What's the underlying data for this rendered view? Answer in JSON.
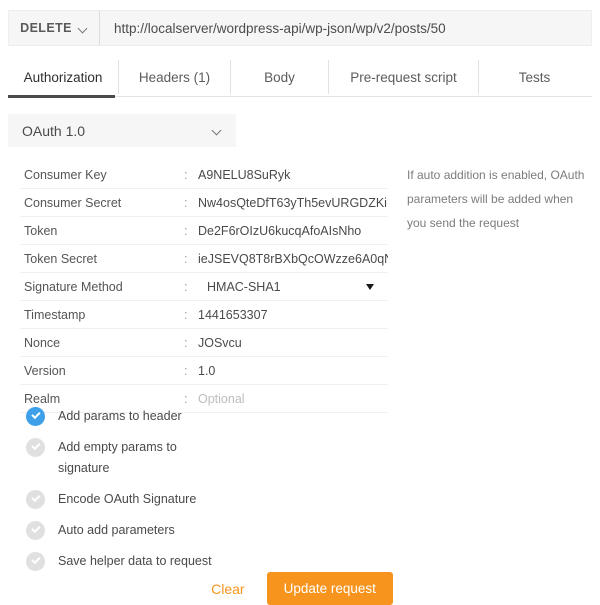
{
  "request_bar": {
    "method": "DELETE",
    "method_icon": "chevron-down-icon",
    "url": "http://localserver/wordpress-api/wp-json/wp/v2/posts/50"
  },
  "tabs": [
    {
      "label": "Authorization",
      "active": true
    },
    {
      "label": "Headers (1)",
      "active": false
    },
    {
      "label": "Body",
      "active": false
    },
    {
      "label": "Pre-request script",
      "active": false
    },
    {
      "label": "Tests",
      "active": false
    }
  ],
  "auth_type": {
    "selected": "OAuth 1.0",
    "icon": "chevron-down-icon"
  },
  "fields": [
    {
      "label": "Consumer Key",
      "separator": ":",
      "value": "A9NELU8SuRyk",
      "placeholder": false,
      "dropdown": false
    },
    {
      "label": "Consumer Secret",
      "separator": ":",
      "value": "Nw4osQteDfT63yTh5evURGDZKi",
      "placeholder": false,
      "dropdown": false
    },
    {
      "label": "Token",
      "separator": ":",
      "value": "De2F6rOIzU6kucqAfoAIsNho",
      "placeholder": false,
      "dropdown": false
    },
    {
      "label": "Token Secret",
      "separator": ":",
      "value": "ieJSEVQ8T8rBXbQcOWzze6A0qN",
      "placeholder": false,
      "dropdown": false
    },
    {
      "label": "Signature Method",
      "separator": ":",
      "value": "HMAC-SHA1",
      "placeholder": false,
      "dropdown": true
    },
    {
      "label": "Timestamp",
      "separator": ":",
      "value": "1441653307",
      "placeholder": false,
      "dropdown": false
    },
    {
      "label": "Nonce",
      "separator": ":",
      "value": "JOSvcu",
      "placeholder": false,
      "dropdown": false
    },
    {
      "label": "Version",
      "separator": ":",
      "value": "1.0",
      "placeholder": false,
      "dropdown": false
    },
    {
      "label": "Realm",
      "separator": ":",
      "value": "Optional",
      "placeholder": true,
      "dropdown": false
    }
  ],
  "help": {
    "text": "If auto addition is enabled, OAuth parameters will be added when you send the request"
  },
  "checkboxes": [
    {
      "label": "Add params to header",
      "checked": true
    },
    {
      "label": "Add empty params to signature",
      "checked": false
    },
    {
      "label": "Encode OAuth Signature",
      "checked": false
    },
    {
      "label": "Auto add parameters",
      "checked": false
    },
    {
      "label": "Save helper data to request",
      "checked": false
    }
  ],
  "actions": {
    "clear_label": "Clear",
    "update_label": "Update request"
  },
  "colors": {
    "accent_orange": "#f7941e",
    "checkbox_on": "#3fa0ea",
    "checkbox_off": "#e0e0e0",
    "tab_active_underline": "#4a4a4a",
    "bar_background": "#f6f6f6"
  }
}
